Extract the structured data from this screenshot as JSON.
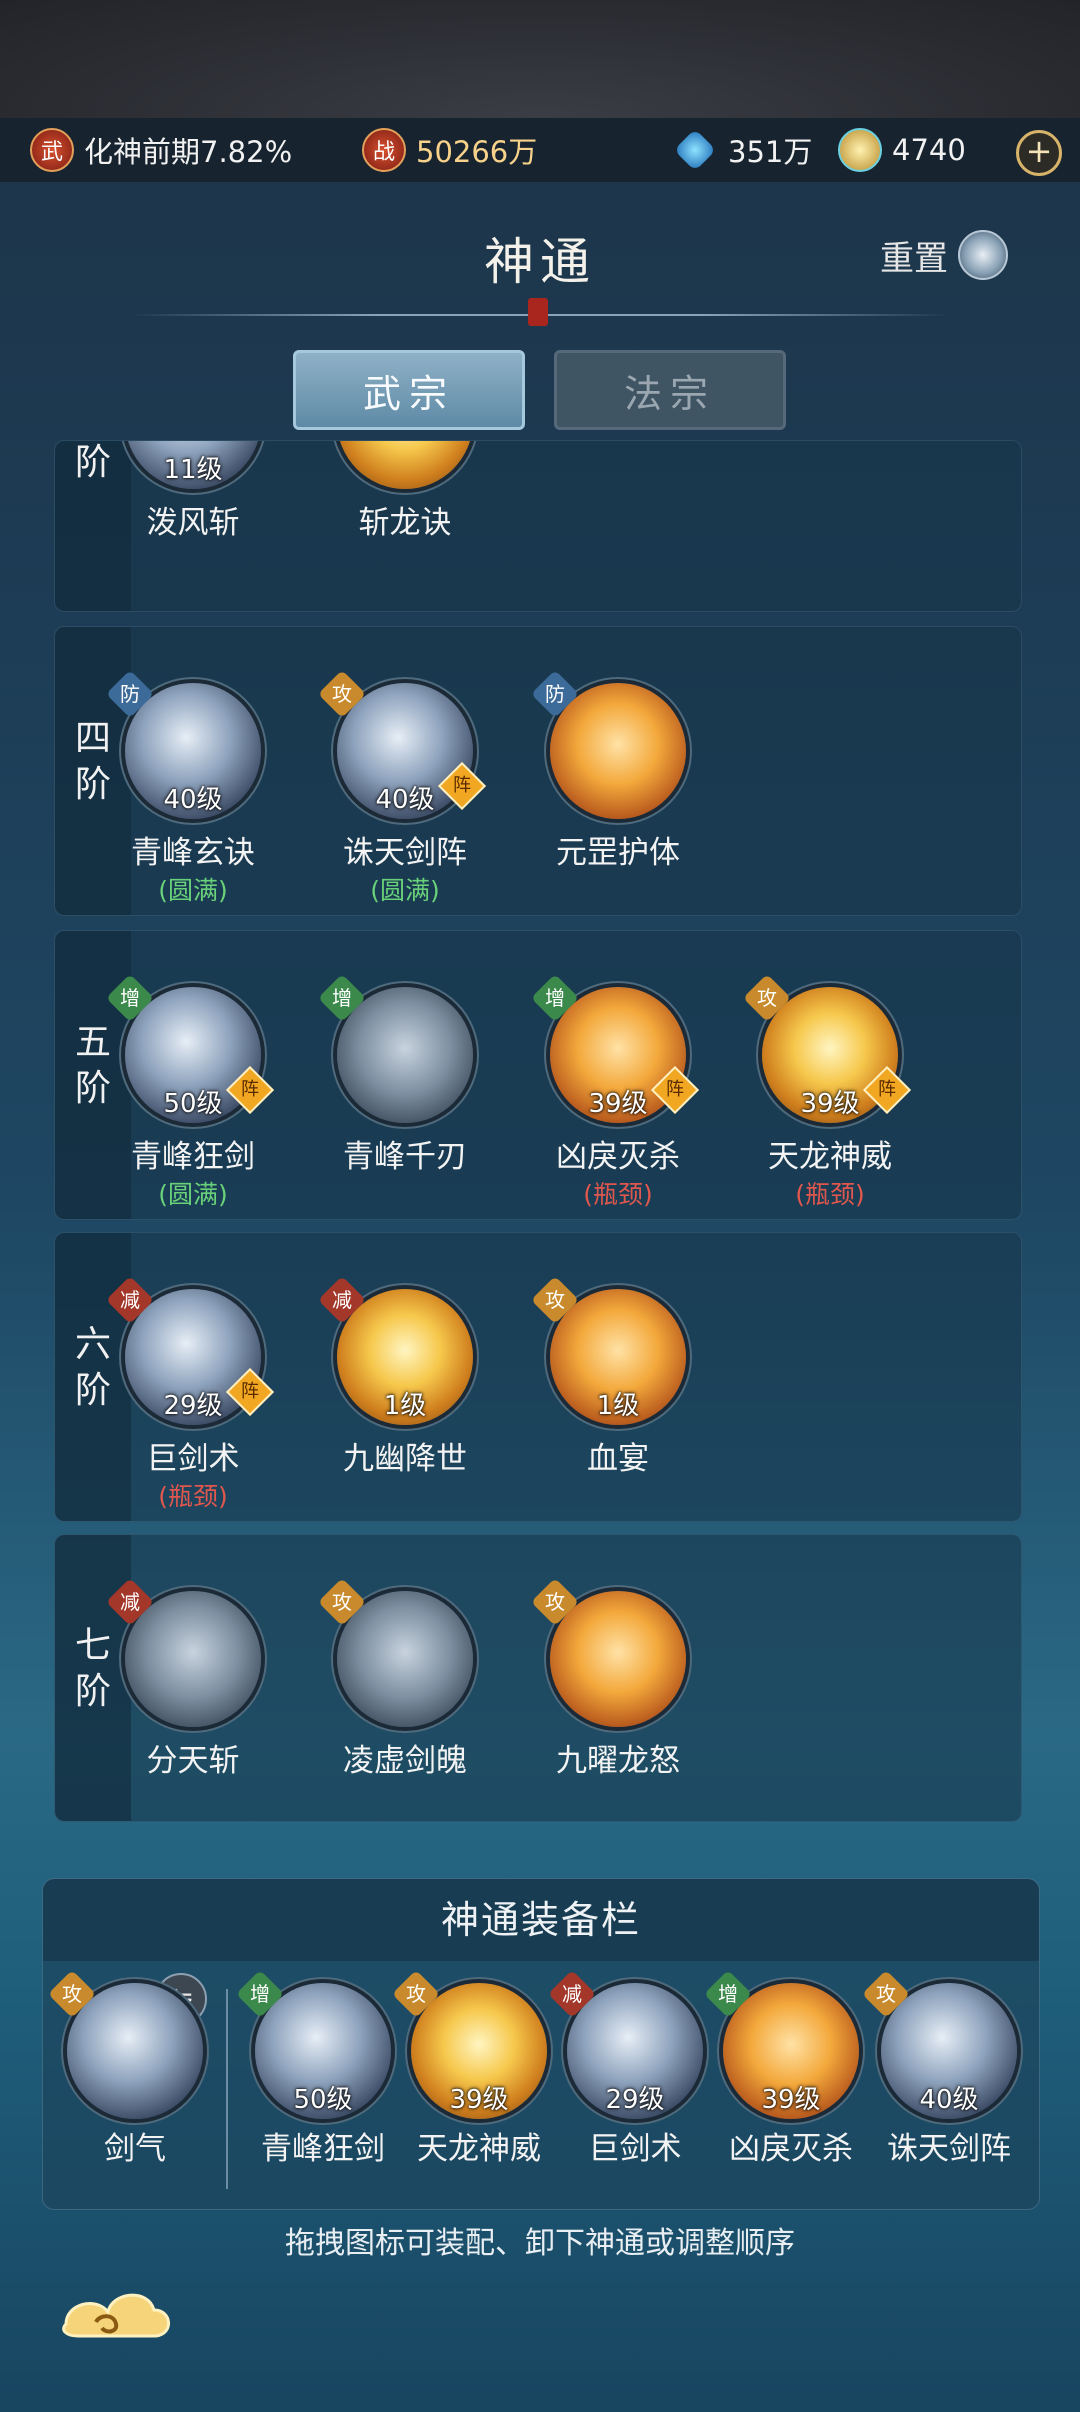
{
  "status": {
    "realm_icon": "武",
    "realm": "化神前期7.82%",
    "power_icon": "战",
    "power": "50266万",
    "spirit": "351万",
    "jade": "4740",
    "plus": "+"
  },
  "header": {
    "title": "神通",
    "reset": "重置"
  },
  "tabs": [
    {
      "label": "武宗",
      "active": true
    },
    {
      "label": "法宗",
      "active": false
    }
  ],
  "tiers": [
    {
      "label": [
        "阶"
      ],
      "skills": [
        {
          "name": "泼风斩",
          "level": "11级",
          "color": "blue"
        },
        {
          "name": "斩龙诀",
          "level": "",
          "color": "gold"
        }
      ]
    },
    {
      "label": [
        "四",
        "阶"
      ],
      "skills": [
        {
          "name": "青峰玄诀",
          "level": "40级",
          "tag": "防",
          "status": "(圆满)",
          "status_color": "green",
          "color": "blue"
        },
        {
          "name": "诛天剑阵",
          "level": "40级",
          "tag": "攻",
          "formation": "阵",
          "status": "(圆满)",
          "status_color": "green",
          "color": "blue"
        },
        {
          "name": "元罡护体",
          "level": "",
          "tag": "防",
          "color": "orange"
        }
      ]
    },
    {
      "label": [
        "五",
        "阶"
      ],
      "skills": [
        {
          "name": "青峰狂剑",
          "level": "50级",
          "tag": "增",
          "formation": "阵",
          "status": "(圆满)",
          "status_color": "green",
          "color": "blue"
        },
        {
          "name": "青峰千刃",
          "level": "",
          "tag": "增",
          "color": "gray"
        },
        {
          "name": "凶戾灭杀",
          "level": "39级",
          "tag": "增",
          "formation": "阵",
          "status": "(瓶颈)",
          "status_color": "red",
          "color": "orange"
        },
        {
          "name": "天龙神威",
          "level": "39级",
          "tag": "攻",
          "formation": "阵",
          "status": "(瓶颈)",
          "status_color": "red",
          "color": "gold"
        }
      ]
    },
    {
      "label": [
        "六",
        "阶"
      ],
      "skills": [
        {
          "name": "巨剑术",
          "level": "29级",
          "tag": "减",
          "formation": "阵",
          "status": "(瓶颈)",
          "status_color": "red",
          "color": "blue"
        },
        {
          "name": "九幽降世",
          "level": "1级",
          "tag": "减",
          "color": "gold"
        },
        {
          "name": "血宴",
          "level": "1级",
          "tag": "攻",
          "color": "orange"
        }
      ]
    },
    {
      "label": [
        "七",
        "阶"
      ],
      "skills": [
        {
          "name": "分天斩",
          "level": "",
          "tag": "减",
          "color": "gray"
        },
        {
          "name": "凌虚剑魄",
          "level": "",
          "tag": "攻",
          "color": "gray"
        },
        {
          "name": "九曜龙怒",
          "level": "",
          "tag": "攻",
          "color": "orange"
        }
      ]
    }
  ],
  "equip": {
    "title": "神通装备栏",
    "swap": "⇋",
    "slots": [
      {
        "name": "剑气",
        "level": "",
        "tag": "攻",
        "color": "blue"
      },
      {
        "name": "青峰狂剑",
        "level": "50级",
        "tag": "增",
        "color": "blue"
      },
      {
        "name": "天龙神威",
        "level": "39级",
        "tag": "攻",
        "color": "gold"
      },
      {
        "name": "巨剑术",
        "level": "29级",
        "tag": "减",
        "color": "blue"
      },
      {
        "name": "凶戾灭杀",
        "level": "39级",
        "tag": "增",
        "color": "orange"
      },
      {
        "name": "诛天剑阵",
        "level": "40级",
        "tag": "攻",
        "color": "blue"
      }
    ]
  },
  "hint": "拖拽图标可装配、卸下神通或调整顺序"
}
